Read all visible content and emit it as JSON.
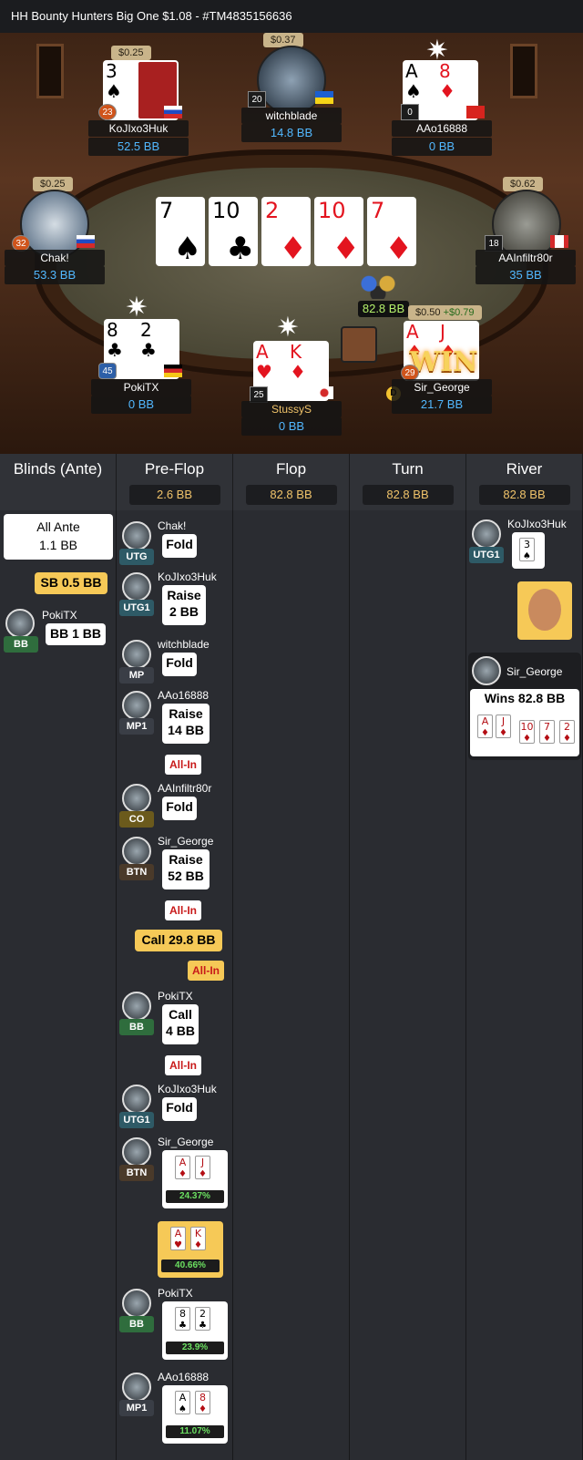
{
  "header": {
    "title": "HH  Bounty Hunters Big One $1.08   - #TM4835156636"
  },
  "table": {
    "pot": "82.8 BB",
    "board": [
      {
        "rank": "7",
        "suit": "♠",
        "color": "black"
      },
      {
        "rank": "10",
        "suit": "♣",
        "color": "black"
      },
      {
        "rank": "2",
        "suit": "♦",
        "color": "red"
      },
      {
        "rank": "10",
        "suit": "♦",
        "color": "red"
      },
      {
        "rank": "7",
        "suit": "♦",
        "color": "red"
      }
    ],
    "seats": {
      "kojixo": {
        "name": "KoJIxo3Huk",
        "stack": "52.5 BB",
        "bet": "$0.25",
        "level": "23",
        "cards": [
          {
            "rank": "3",
            "suit": "♠"
          }
        ]
      },
      "witch": {
        "name": "witchblade",
        "stack": "14.8 BB",
        "bet": "$0.37",
        "level": "20"
      },
      "aao": {
        "name": "AAo16888",
        "stack": "0 BB",
        "level": "0",
        "cards": [
          {
            "rank": "A",
            "suit": "♠"
          },
          {
            "rank": "8",
            "suit": "♦"
          }
        ]
      },
      "chak": {
        "name": "Chak!",
        "stack": "53.3 BB",
        "bet": "$0.25",
        "level": "32"
      },
      "aainf": {
        "name": "AAInfiltr80r",
        "stack": "35 BB",
        "bet": "$0.62",
        "level": "18"
      },
      "poki": {
        "name": "PokiTX",
        "stack": "0 BB",
        "level": "45",
        "cards": [
          {
            "rank": "8",
            "suit": "♣"
          },
          {
            "rank": "2",
            "suit": "♣"
          }
        ]
      },
      "stussy": {
        "name": "StussyS",
        "stack": "0 BB",
        "level": "25",
        "cards": [
          {
            "rank": "A",
            "suit": "♥"
          },
          {
            "rank": "K",
            "suit": "♦"
          }
        ]
      },
      "george": {
        "name": "Sir_George",
        "stack": "21.7 BB",
        "bet": "$0.50",
        "bounty": "+$0.79",
        "level": "29",
        "cards": [
          {
            "rank": "A",
            "suit": "♦"
          },
          {
            "rank": "J",
            "suit": "♦"
          }
        ],
        "win_label": "WIN",
        "dealer": "D"
      }
    }
  },
  "columns": [
    {
      "title": "Blinds (Ante)",
      "pot": ""
    },
    {
      "title": "Pre-Flop",
      "pot": "2.6 BB"
    },
    {
      "title": "Flop",
      "pot": "82.8 BB"
    },
    {
      "title": "Turn",
      "pot": "82.8 BB"
    },
    {
      "title": "River",
      "pot": "82.8 BB"
    }
  ],
  "blinds": {
    "ante": "All Ante\n1.1 BB",
    "sb": "SB 0.5 BB",
    "bb_player": "PokiTX",
    "bb_pos": "BB",
    "bb": "BB 1 BB"
  },
  "preflop": [
    {
      "player": "Chak!",
      "pos": "UTG",
      "action": "Fold"
    },
    {
      "player": "KoJIxo3Huk",
      "pos": "UTG1",
      "action": "Raise\n2 BB"
    },
    {
      "player": "witchblade",
      "pos": "MP",
      "action": "Fold"
    },
    {
      "player": "AAo16888",
      "pos": "MP1",
      "action": "Raise\n14 BB",
      "allin": "All-In"
    },
    {
      "player": "AAInfiltr80r",
      "pos": "CO",
      "action": "Fold"
    },
    {
      "player": "Sir_George",
      "pos": "BTN",
      "action": "Raise\n52 BB",
      "allin": "All-In"
    },
    {
      "action": "Call 29.8 BB",
      "allin": "All-In"
    },
    {
      "player": "PokiTX",
      "pos": "BB",
      "action": "Call\n4 BB",
      "allin": "All-In"
    },
    {
      "player": "KoJIxo3Huk",
      "pos": "UTG1",
      "action": "Fold"
    }
  ],
  "showdown": [
    {
      "player": "Sir_George",
      "pos": "BTN",
      "equity": "24.37%"
    },
    {
      "equity": "40.66%"
    },
    {
      "player": "PokiTX",
      "pos": "BB",
      "equity": "23.9%"
    },
    {
      "player": "AAo16888",
      "pos": "MP1",
      "equity": "11.07%"
    }
  ],
  "river": {
    "player": "KoJIxo3Huk",
    "pos": "UTG1",
    "winner": "Sir_George",
    "wins": "Wins 82.8 BB"
  },
  "colors": {
    "accent": "#f6c957",
    "stack_blue": "#52b8ff",
    "equity_green": "#6be061",
    "allin_red": "#c81a1a"
  }
}
